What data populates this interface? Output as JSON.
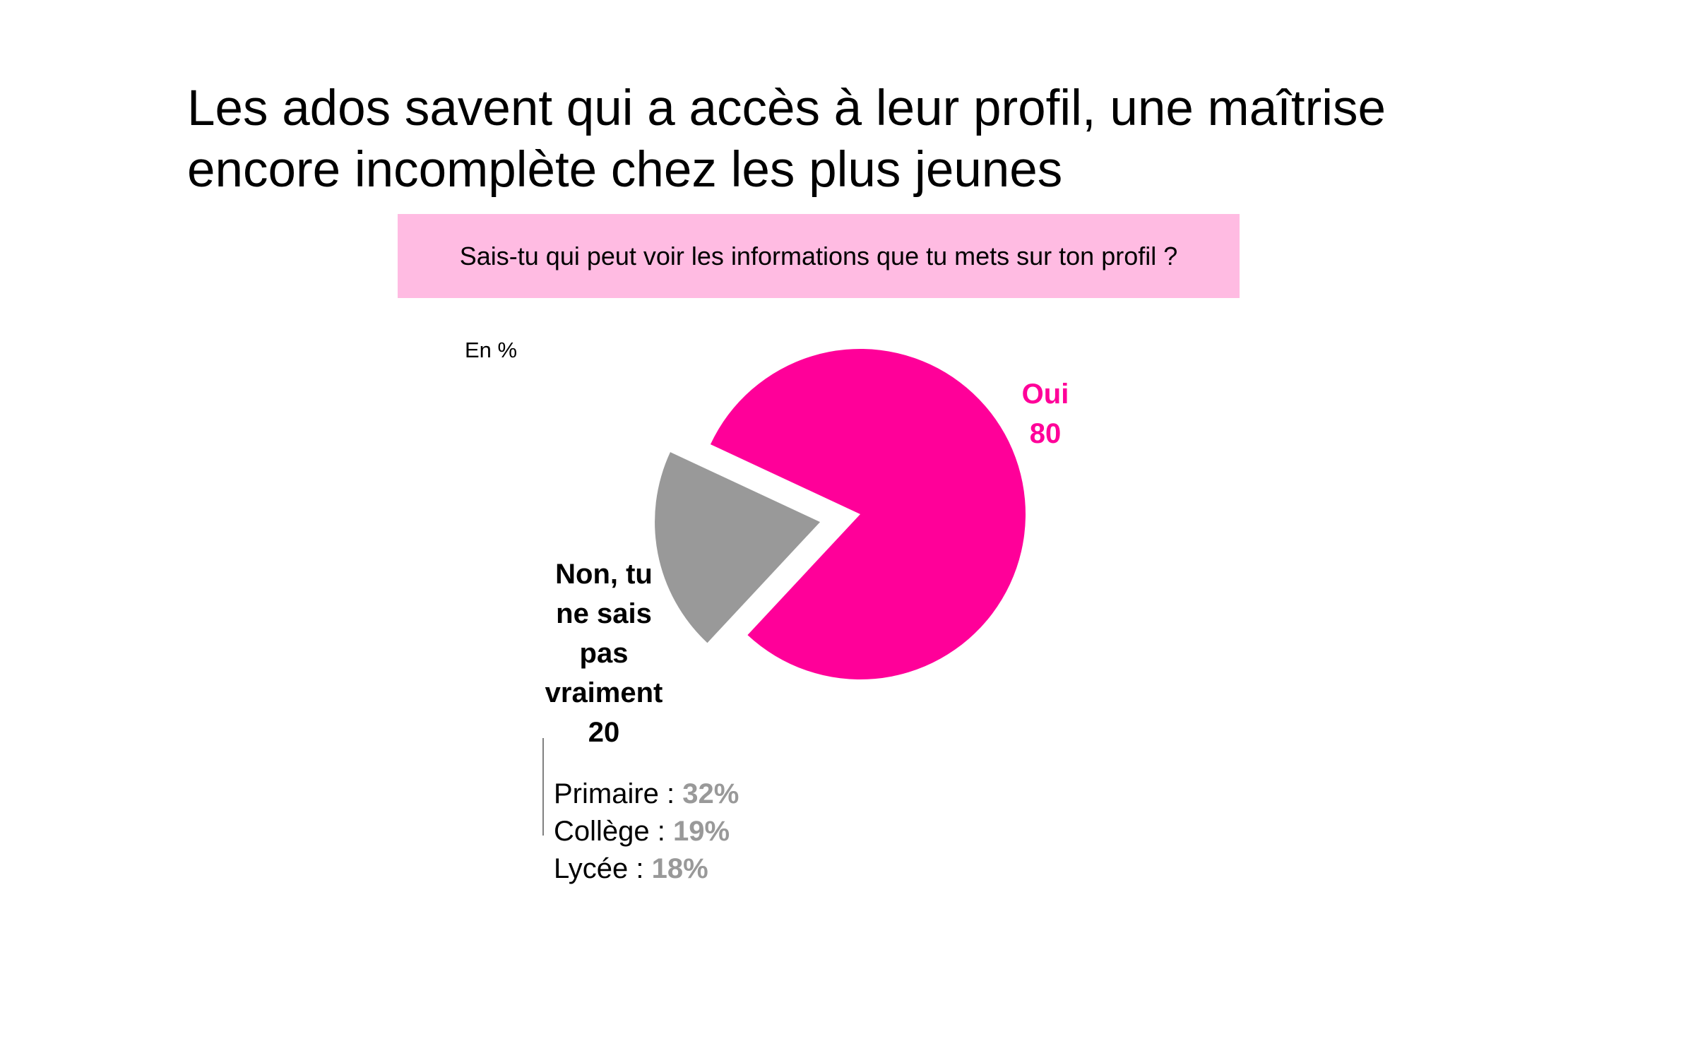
{
  "title": {
    "line1": "Les ados savent qui a accès à leur profil, une maîtrise",
    "line2": "encore incomplète chez les plus jeunes"
  },
  "question": "Sais-tu qui peut voir les informations que tu mets sur ton profil ?",
  "unit": "En %",
  "colors": {
    "oui": "#ff0099",
    "non": "#999999",
    "question_background": "#ffbbe2"
  },
  "chart_data": {
    "type": "pie",
    "title": "",
    "exploded": "Non, tu ne sais pas vraiment",
    "slices": [
      {
        "label_lines": [
          "Oui"
        ],
        "value": 80,
        "value_text": "80",
        "color": "#ff0099"
      },
      {
        "label_lines": [
          "Non, tu",
          "ne sais",
          "pas",
          "vraiment"
        ],
        "value": 20,
        "value_text": "20",
        "color": "#999999"
      }
    ]
  },
  "breakdown": [
    {
      "label": "Primaire : ",
      "value": "32%"
    },
    {
      "label": "Collège : ",
      "value": "19%"
    },
    {
      "label": "Lycée : ",
      "value": "18%"
    }
  ]
}
